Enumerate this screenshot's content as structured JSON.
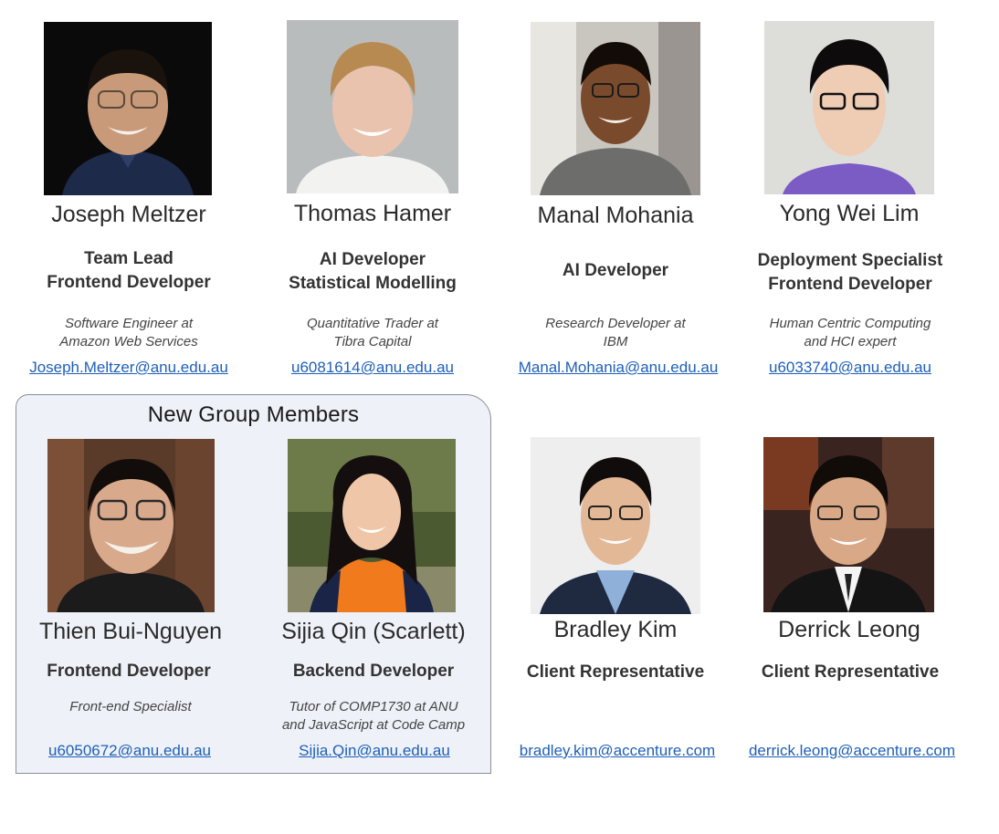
{
  "group_box": {
    "title": "New Group Members"
  },
  "members": [
    {
      "name": "Joseph Meltzer",
      "roles": [
        "Team Lead",
        "Frontend Developer"
      ],
      "desc": [
        "Software Engineer at",
        "Amazon Web Services"
      ],
      "email": "Joseph.Meltzer@anu.edu.au"
    },
    {
      "name": "Thomas Hamer",
      "roles": [
        "AI Developer",
        "Statistical Modelling"
      ],
      "desc": [
        "Quantitative Trader at",
        "Tibra Capital"
      ],
      "email": "u6081614@anu.edu.au"
    },
    {
      "name": "Manal Mohania",
      "roles": [
        "AI Developer"
      ],
      "desc": [
        "Research Developer at",
        "IBM"
      ],
      "email": "Manal.Mohania@anu.edu.au"
    },
    {
      "name": "Yong Wei Lim",
      "roles": [
        "Deployment Specialist",
        "Frontend Developer"
      ],
      "desc": [
        "Human Centric Computing",
        "and HCI expert"
      ],
      "email": "u6033740@anu.edu.au"
    },
    {
      "name": "Thien Bui-Nguyen",
      "roles": [
        "Frontend Developer"
      ],
      "desc": [
        "Front-end Specialist"
      ],
      "email": "u6050672@anu.edu.au"
    },
    {
      "name": "Sijia Qin (Scarlett)",
      "roles": [
        "Backend Developer"
      ],
      "desc": [
        "Tutor of COMP1730 at ANU",
        "and JavaScript at Code Camp"
      ],
      "email": "Sijia.Qin@anu.edu.au"
    },
    {
      "name": "Bradley Kim",
      "roles": [
        "Client Representative"
      ],
      "desc": [],
      "email": "bradley.kim@accenture.com"
    },
    {
      "name": "Derrick Leong",
      "roles": [
        "Client Representative"
      ],
      "desc": [],
      "email": "derrick.leong@accenture.com"
    }
  ],
  "colors": {
    "link": "#1f5fb8",
    "group_box_bg": "#eef2f8",
    "group_box_border": "#8a8f96"
  }
}
